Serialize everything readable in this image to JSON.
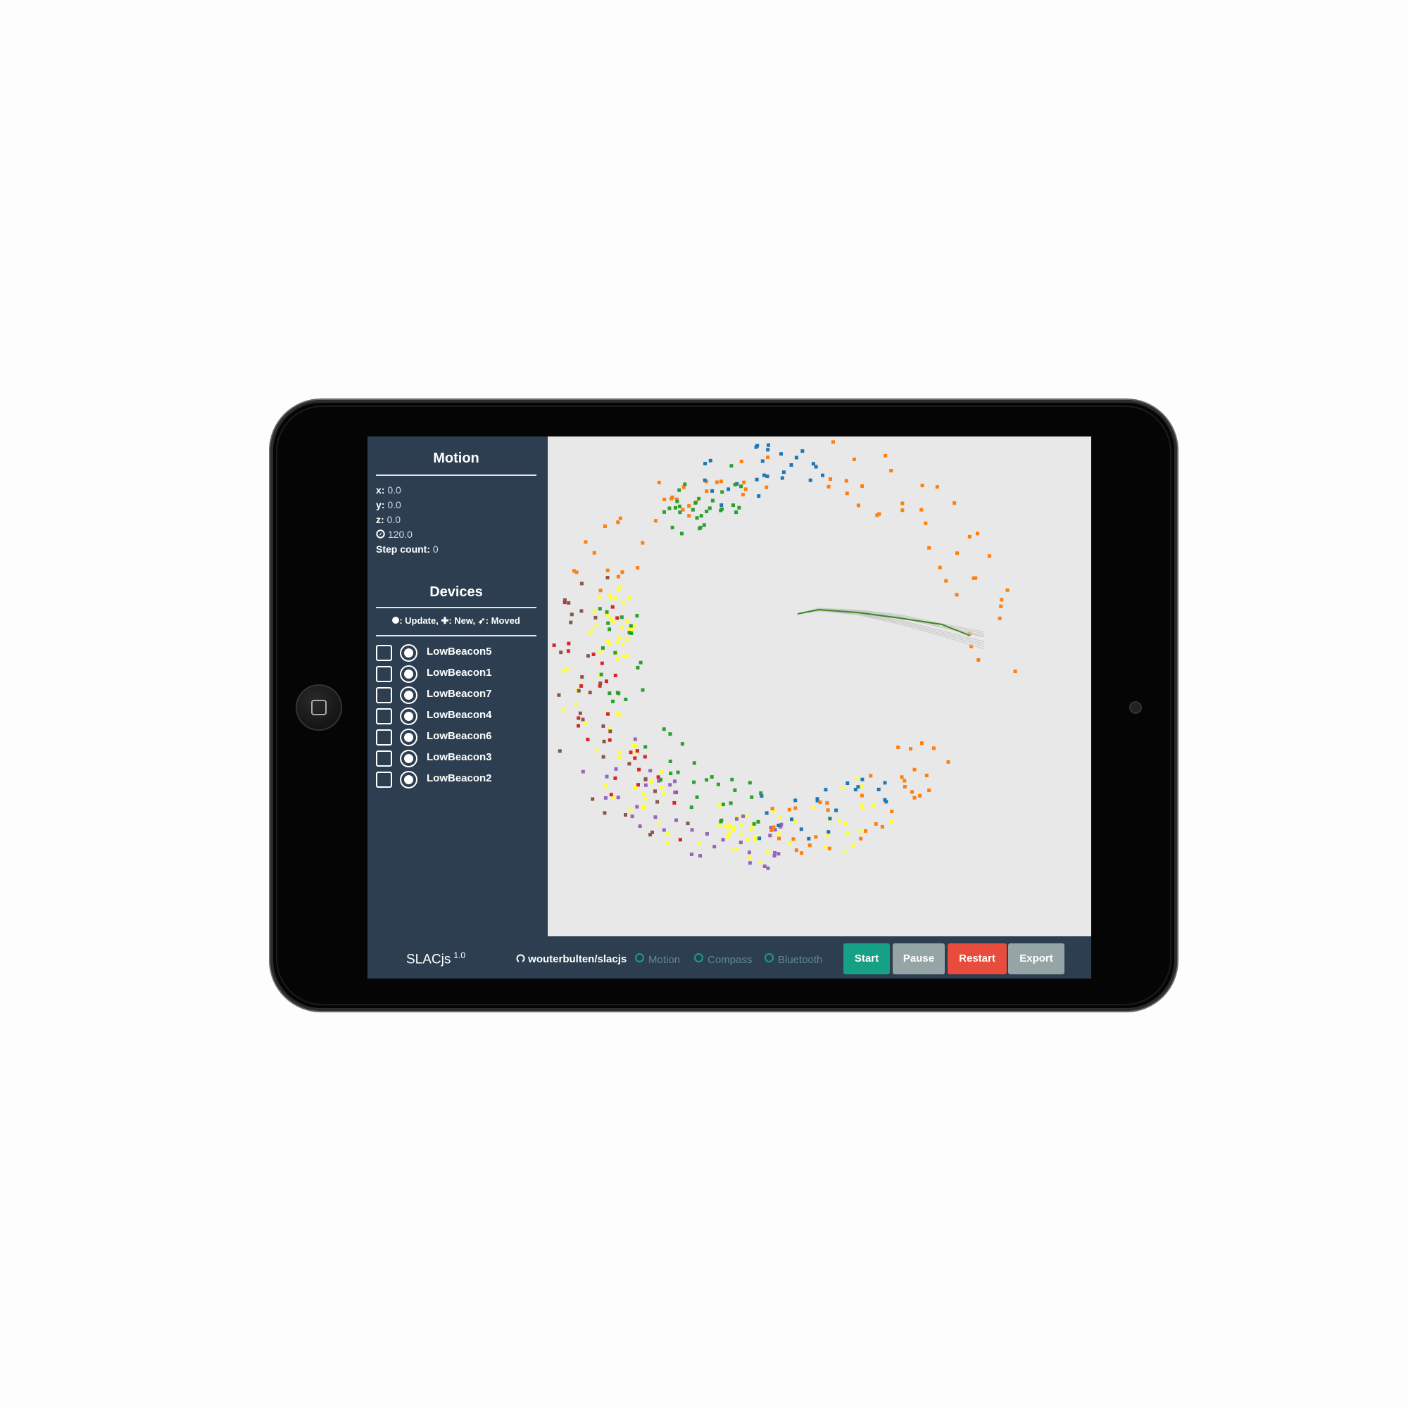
{
  "motion": {
    "title": "Motion",
    "x_label": "x:",
    "x_value": "0.0",
    "y_label": "y:",
    "y_value": "0.0",
    "z_label": "z:",
    "z_value": "0.0",
    "heading_value": "120.0",
    "step_label": "Step count:",
    "step_value": "0"
  },
  "devices": {
    "title": "Devices",
    "legend_update": ": Update,",
    "legend_new": ": New,",
    "legend_moved": ": Moved",
    "items": [
      {
        "label": "LowBeacon5"
      },
      {
        "label": "LowBeacon1"
      },
      {
        "label": "LowBeacon7"
      },
      {
        "label": "LowBeacon4"
      },
      {
        "label": "LowBeacon6"
      },
      {
        "label": "LowBeacon3"
      },
      {
        "label": "LowBeacon2"
      }
    ]
  },
  "footer": {
    "brand": "SLACjs",
    "version": "1.0",
    "repo": "wouterbulten/slacjs",
    "indicators": [
      "Motion",
      "Compass",
      "Bluetooth"
    ],
    "buttons": {
      "start": "Start",
      "pause": "Pause",
      "restart": "Restart",
      "export": "Export"
    }
  },
  "colors": {
    "sidebar": "#2c3e50",
    "canvas": "#e8e8e8",
    "start": "#16a085",
    "pause": "#95a5a6",
    "restart": "#e74c3c",
    "export": "#95a5a6",
    "path": "#3a8a1e",
    "beacons": [
      "#1f77b4",
      "#ff7f0e",
      "#2ca02c",
      "#d62728",
      "#9467bd",
      "#8c564b",
      "#ffff33"
    ]
  },
  "icons": [
    "github-icon",
    "compass-icon",
    "circle-icon",
    "plus-icon",
    "arrow-icon"
  ]
}
